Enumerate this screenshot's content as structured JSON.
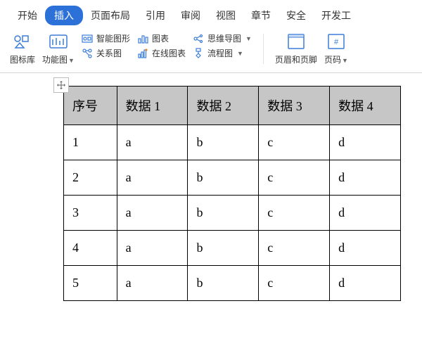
{
  "tabs": [
    "开始",
    "插入",
    "页面布局",
    "引用",
    "审阅",
    "视图",
    "章节",
    "安全",
    "开发工"
  ],
  "active_tab": "插入",
  "toolbar": {
    "icon_lib": "图标库",
    "func_chart": "功能图",
    "smart_graphic": "智能图形",
    "chart": "图表",
    "relation": "关系图",
    "online_chart": "在线图表",
    "mindmap": "思维导图",
    "flowchart": "流程图",
    "header_footer": "页眉和页脚",
    "page_number": "页码"
  },
  "table": {
    "headers": [
      "序号",
      "数据 1",
      "数据 2",
      "数据 3",
      "数据 4"
    ],
    "rows": [
      [
        "1",
        "a",
        "b",
        "c",
        "d"
      ],
      [
        "2",
        "a",
        "b",
        "c",
        "d"
      ],
      [
        "3",
        "a",
        "b",
        "c",
        "d"
      ],
      [
        "4",
        "a",
        "b",
        "c",
        "d"
      ],
      [
        "5",
        "a",
        "b",
        "c",
        "d"
      ]
    ]
  }
}
